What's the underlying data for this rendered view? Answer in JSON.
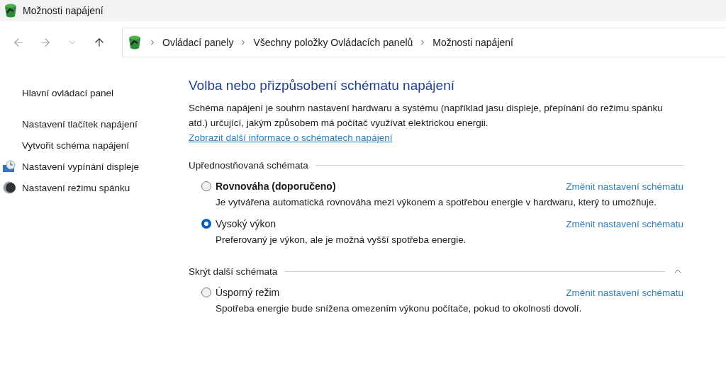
{
  "window": {
    "title": "Možnosti napájení"
  },
  "nav": [
    {
      "kind": "back",
      "disabled": true
    },
    {
      "kind": "forward",
      "disabled": true
    },
    {
      "kind": "recent",
      "disabled": true
    },
    {
      "kind": "up",
      "disabled": false
    }
  ],
  "breadcrumb": [
    "Ovládací panely",
    "Všechny položky Ovládacích panelů",
    "Možnosti napájení"
  ],
  "sidebar": {
    "home": "Hlavní ovládací panel",
    "items": [
      {
        "label": "Nastavení tlačítek napájení",
        "kind": "plain"
      },
      {
        "label": "Vytvořit schéma napájení",
        "kind": "plain"
      },
      {
        "label": "Nastavení vypínání displeje",
        "kind": "display"
      },
      {
        "label": "Nastavení režimu spánku",
        "kind": "sleep"
      }
    ]
  },
  "heading": "Volba nebo přizpůsobení schématu napájení",
  "intro": {
    "text": "Schéma napájení je souhrn nastavení hardwaru a systému (například jasu displeje, přepínání do režimu spánku atd.) určující, jakým způsobem má počítač využívat elektrickou energii.",
    "link": "Zobrazit další informace o schématech napájení"
  },
  "groups": [
    {
      "kind": "plain",
      "label": "Upřednostňovaná schémata",
      "schemes": [
        {
          "name": "Rovnováha (doporučeno)",
          "recommended": true,
          "selected": false,
          "description": "Je vytvářena automatická rovnováha mezi výkonem a spotřebou energie v hardwaru, který to umožňuje.",
          "link": "Změnit nastavení schématu"
        },
        {
          "name": "Vysoký výkon",
          "recommended": false,
          "selected": true,
          "description": "Preferovaný je výkon, ale je možná vyšší spotřeba energie.",
          "link": "Změnit nastavení schématu"
        }
      ]
    },
    {
      "kind": "collapsible",
      "label": "Skrýt další schémata",
      "expanded": true,
      "schemes": [
        {
          "name": "Úsporný režim",
          "recommended": false,
          "selected": false,
          "description": "Spotřeba energie bude snížena omezením výkonu počítače, pokud to okolnosti dovolí.",
          "link": "Změnit nastavení schématu"
        }
      ]
    }
  ]
}
